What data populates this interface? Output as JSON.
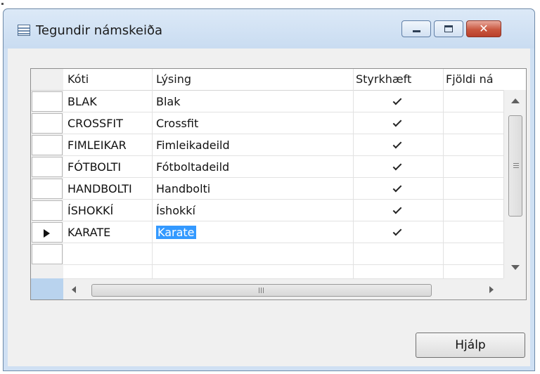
{
  "window": {
    "title": "Tegundir námskeiða",
    "close_glyph": "✕"
  },
  "columns": [
    {
      "label": "Kóti"
    },
    {
      "label": "Lýsing"
    },
    {
      "label": "Styrkhæft"
    },
    {
      "label": "Fjöldi ná"
    }
  ],
  "rows": [
    {
      "code": "BLAK",
      "description": "Blak",
      "styrkhaeft": true
    },
    {
      "code": "CROSSFIT",
      "description": "Crossfit",
      "styrkhaeft": true
    },
    {
      "code": "FIMLEIKAR",
      "description": "Fimleikadeild",
      "styrkhaeft": true
    },
    {
      "code": "FÓTBOLTI",
      "description": "Fótboltadeild",
      "styrkhaeft": true
    },
    {
      "code": "HANDBOLTI",
      "description": "Handbolti",
      "styrkhaeft": true
    },
    {
      "code": "ÍSHOKKÍ",
      "description": "Íshokkí",
      "styrkhaeft": true
    },
    {
      "code": "KARATE",
      "description": "Karate",
      "styrkhaeft": true,
      "current": true,
      "description_selected": true
    }
  ],
  "scrollbar": {
    "h_grip": "III",
    "v_grip": "≡"
  },
  "buttons": {
    "help": "Hjálp"
  },
  "icons": {
    "window": "table-window-icon",
    "minimize": "minimize-icon",
    "maximize": "maximize-icon",
    "close": "close-icon",
    "current_row": "current-row-arrow-icon",
    "check": "checkmark-icon"
  },
  "colors": {
    "selection": "#3399ff",
    "close_button": "#c9573f",
    "titlebar": "#cfe0f3"
  }
}
